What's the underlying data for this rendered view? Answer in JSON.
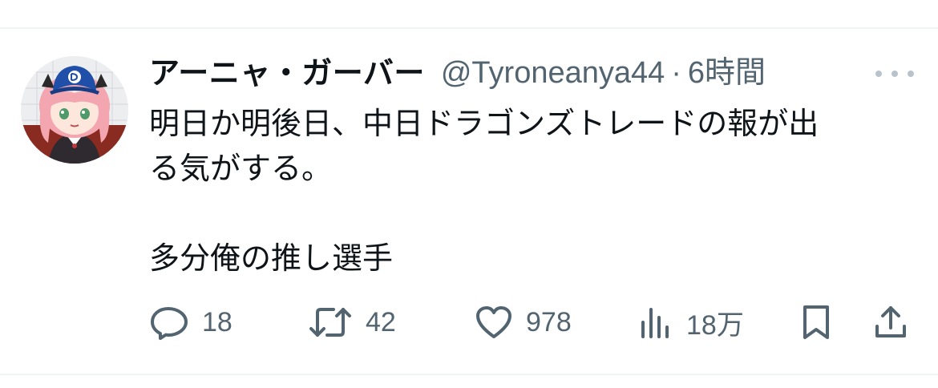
{
  "tweet": {
    "author": {
      "display_name": "アーニャ・ガーバー",
      "handle": "@Tyroneanya44",
      "separator": "·",
      "timestamp": "6時間"
    },
    "text": {
      "line1": "明日か明後日、中日ドラゴンズトレードの報が出",
      "line2": "る気がする。",
      "line3": "多分俺の推し選手"
    },
    "actions": {
      "reply": {
        "icon": "reply-icon",
        "count": "18"
      },
      "retweet": {
        "icon": "retweet-icon",
        "count": "42"
      },
      "like": {
        "icon": "heart-icon",
        "count": "978"
      },
      "views": {
        "icon": "views-chart-icon",
        "count": "18万"
      },
      "bookmark": {
        "icon": "bookmark-icon"
      },
      "share": {
        "icon": "share-icon"
      }
    }
  },
  "colors": {
    "text_primary": "#0f1419",
    "text_secondary": "#536471",
    "divider": "#eff3f4",
    "more_dots": "#b9c3cb"
  }
}
